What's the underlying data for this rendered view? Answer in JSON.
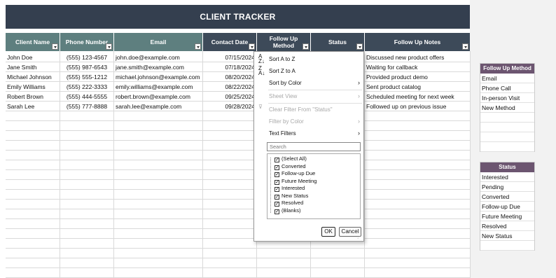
{
  "title": "CLIENT TRACKER",
  "columns": [
    {
      "label": "Client Name"
    },
    {
      "label": "Phone Number"
    },
    {
      "label": "Email"
    },
    {
      "label": "Contact Date"
    },
    {
      "label": "Follow Up\nMethod"
    },
    {
      "label": "Status"
    },
    {
      "label": "Follow Up Notes"
    }
  ],
  "rows": [
    {
      "name": "John Doe",
      "phone": "(555) 123-4567",
      "email": "john.doe@example.com",
      "date": "07/15/2024",
      "notes": "Discussed new product offers"
    },
    {
      "name": "Jane Smith",
      "phone": "(555) 987-6543",
      "email": "jane.smith@example.com",
      "date": "07/18/2024",
      "notes": "Waiting for callback"
    },
    {
      "name": "Michael Johnson",
      "phone": "(555) 555-1212",
      "email": "michael.johnson@example.com",
      "date": "08/20/2024",
      "notes": "Provided product demo"
    },
    {
      "name": "Emily Williams",
      "phone": "(555) 222-3333",
      "email": "emily.williams@example.com",
      "date": "08/22/2024",
      "notes": "Sent product catalog"
    },
    {
      "name": "Robert Brown",
      "phone": "(555) 444-5555",
      "email": "robert.brown@example.com",
      "date": "09/25/2024",
      "notes": "Scheduled meeting for next week"
    },
    {
      "name": "Sarah Lee",
      "phone": "(555) 777-8888",
      "email": "sarah.lee@example.com",
      "date": "09/28/2024",
      "notes": "Followed up on previous issue"
    }
  ],
  "filter_menu": {
    "sort_az": "Sort A to Z",
    "sort_za": "Sort Z to A",
    "sort_color": "Sort by Color",
    "sheet_view": "Sheet View",
    "clear_filter": "Clear Filter From \"Status\"",
    "filter_color": "Filter by Color",
    "text_filters": "Text Filters",
    "search_placeholder": "Search",
    "items": [
      "(Select All)",
      "Converted",
      "Follow-up Due",
      "Future Meeting",
      "Interested",
      "New Status",
      "Resolved",
      "(Blanks)"
    ],
    "ok": "OK",
    "cancel": "Cancel"
  },
  "follow_up_method": {
    "header": "Follow Up Method",
    "items": [
      "Email",
      "Phone Call",
      "In-person Visit",
      "New Method"
    ]
  },
  "status_list": {
    "header": "Status",
    "items": [
      "Interested",
      "Pending",
      "Converted",
      "Follow-up Due",
      "Future Meeting",
      "Resolved",
      "New Status"
    ]
  },
  "colors": {
    "title_bg": "#343f4f",
    "header_teal": "#5e7f7f",
    "header_dark": "#3d4a59",
    "side_header": "#6c5570"
  }
}
